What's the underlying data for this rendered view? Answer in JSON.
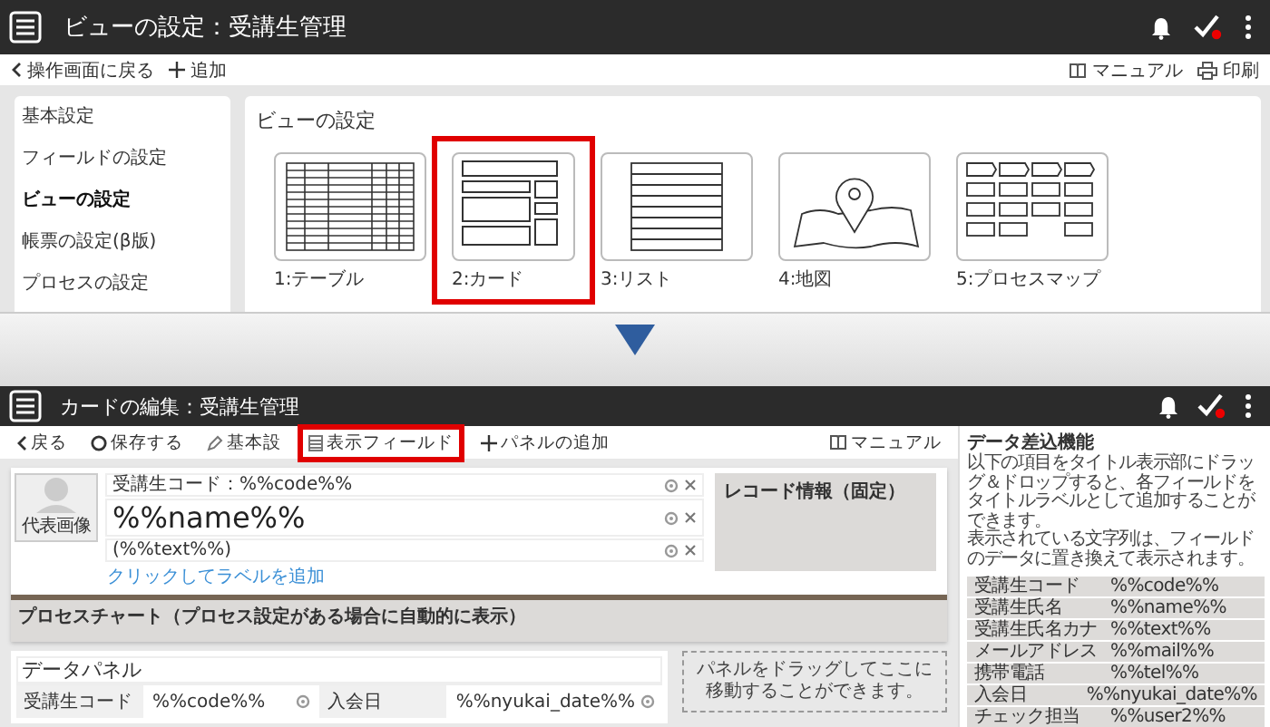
{
  "top": {
    "header": {
      "title": "ビューの設定：受講生管理"
    },
    "toolbar": {
      "back": "操作画面に戻る",
      "add": "追加",
      "manual": "マニュアル",
      "print": "印刷"
    },
    "sidebar": {
      "items": [
        {
          "label": "基本設定",
          "selected": false
        },
        {
          "label": "フィールドの設定",
          "selected": false
        },
        {
          "label": "ビューの設定",
          "selected": true
        },
        {
          "label": "帳票の設定(β版)",
          "selected": false
        },
        {
          "label": "プロセスの設定",
          "selected": false
        }
      ]
    },
    "panel": {
      "title": "ビューの設定",
      "views": [
        {
          "label": "1:テーブル",
          "kind": "table",
          "selected": false
        },
        {
          "label": "2:カード",
          "kind": "card",
          "selected": true
        },
        {
          "label": "3:リスト",
          "kind": "list",
          "selected": false
        },
        {
          "label": "4:地図",
          "kind": "map",
          "selected": false
        },
        {
          "label": "5:プロセスマップ",
          "kind": "process",
          "selected": false
        }
      ]
    }
  },
  "bottom": {
    "header": {
      "title": "カードの編集：受講生管理"
    },
    "toolbar": {
      "items": [
        {
          "label": "戻る",
          "kind": "back",
          "selected": false
        },
        {
          "label": "保存する",
          "kind": "save",
          "selected": false
        },
        {
          "label": "基本設",
          "kind": "settings",
          "selected": false
        },
        {
          "label": "表示フィールド",
          "kind": "fields",
          "selected": true
        },
        {
          "label": "パネルの追加",
          "kind": "add",
          "selected": false
        }
      ],
      "manual": "マニュアル"
    },
    "card": {
      "avatar": "代表画像",
      "code_line": "受講生コード：%%code%%",
      "name_line": "%%name%%",
      "text_line": "(%%text%%)",
      "add_label": "クリックしてラベルを追加",
      "record_info": "レコード情報（固定）",
      "process_chart": "プロセスチャート（プロセス設定がある場合に自動的に表示）"
    },
    "data_panel": {
      "title": "データパネル",
      "fields": [
        {
          "label": "受講生コード",
          "value": "%%code%%"
        },
        {
          "label": "入会日",
          "value": "%%nyukai_date%%"
        }
      ]
    },
    "drop_zone": "パネルをドラッグしてここに移動することができます。",
    "side_panel": {
      "title": "データ差込機能",
      "paragraphs": [
        "以下の項目をタイトル表示部にドラッグ＆ドロップすると、各フィールドをタイトルラベルとして追加することができます。",
        "表示されている文字列は、フィールドのデータに置き換えて表示されます。"
      ],
      "rows": [
        {
          "label": "受講生コード",
          "value": "%%code%%"
        },
        {
          "label": "受講生氏名",
          "value": "%%name%%"
        },
        {
          "label": "受講生氏名カナ",
          "value": "%%text%%"
        },
        {
          "label": "メールアドレス",
          "value": "%%mail%%"
        },
        {
          "label": "携帯電話",
          "value": "%%tel%%"
        },
        {
          "label": "入会日",
          "value": "%%nyukai_date%%"
        },
        {
          "label": "チェック担当",
          "value": "%%user2%%"
        }
      ]
    }
  }
}
